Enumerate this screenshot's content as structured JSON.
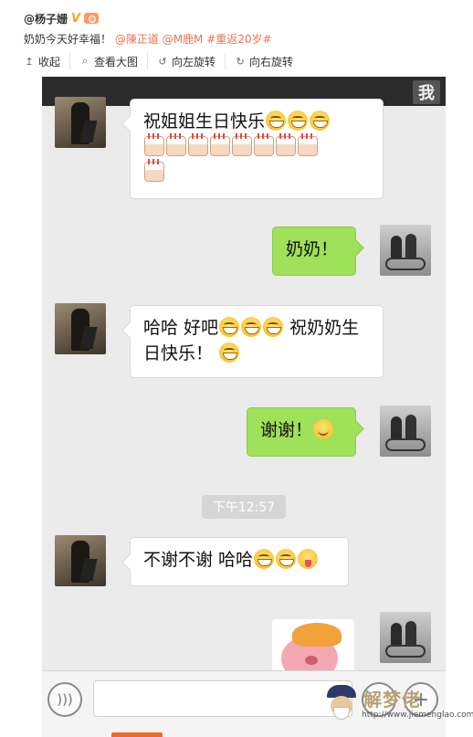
{
  "post": {
    "user": "@杨子姗",
    "text_prefix": "奶奶今天好幸福！",
    "mention1": "@陳正道",
    "mention2": "@M鹿M",
    "hashtag": "#重返20岁#"
  },
  "actions": [
    {
      "icon": "collapse-icon",
      "label": "收起"
    },
    {
      "icon": "zoom-icon",
      "label": "查看大图"
    },
    {
      "icon": "rotate-left-icon",
      "label": "向左旋转"
    },
    {
      "icon": "rotate-right-icon",
      "label": "向右旋转"
    }
  ],
  "chat": {
    "top_icon_glyph": "我",
    "messages": [
      {
        "side": "left",
        "text": "祝姐姐生日快乐"
      },
      {
        "side": "right",
        "text": "奶奶！"
      },
      {
        "side": "left",
        "text_a": "哈哈 好吧",
        "text_b": "祝奶奶生日快乐！"
      },
      {
        "side": "right",
        "text": "谢谢！"
      },
      {
        "side": "left",
        "text": "不谢不谢 哈哈"
      }
    ],
    "timestamp": "下午12:57",
    "input_value": ""
  },
  "watermark": {
    "title": "解梦佬",
    "url": "http://www.jiemenglao.com"
  },
  "colors": {
    "link": "#eb7350",
    "bubble_green": "#9fe158",
    "chat_bg": "#ebebeb"
  }
}
